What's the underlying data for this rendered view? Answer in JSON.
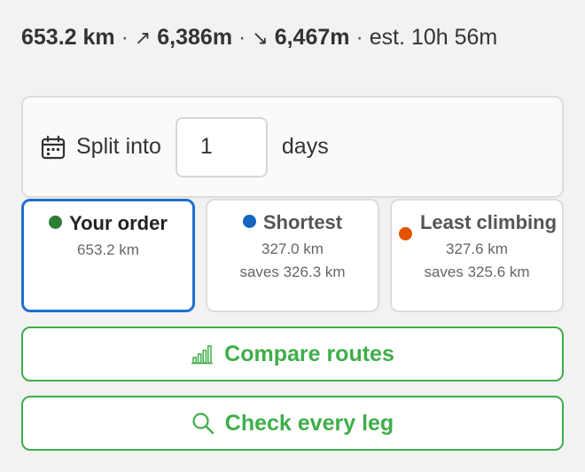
{
  "summary": {
    "distance": "653.2 km",
    "sep": "·",
    "ascent_arrow": "↗",
    "ascent": "6,386m",
    "descent_arrow": "↘",
    "descent": "6,467m",
    "estimate": "est. 10h 56m"
  },
  "split": {
    "label": "Split into",
    "value": "1",
    "unit": "days"
  },
  "options": [
    {
      "title": "Your order",
      "lines": [
        "653.2 km"
      ],
      "color": "#2e7d32",
      "selected": true
    },
    {
      "title": "Shortest",
      "lines": [
        "327.0 km",
        "saves 326.3 km"
      ],
      "color": "#1565c0",
      "selected": false
    },
    {
      "title": "Least climbing",
      "lines": [
        "327.6 km",
        "saves 325.6 km"
      ],
      "color": "#e65100",
      "selected": false
    }
  ],
  "buttons": {
    "compare": "Compare routes",
    "check": "Check every leg"
  },
  "colors": {
    "accent_green": "#3fae49",
    "selected_border": "#1f6fd1"
  },
  "icons": {
    "split": "calendar-icon",
    "compare": "bar-chart-icon",
    "check": "search-icon"
  }
}
